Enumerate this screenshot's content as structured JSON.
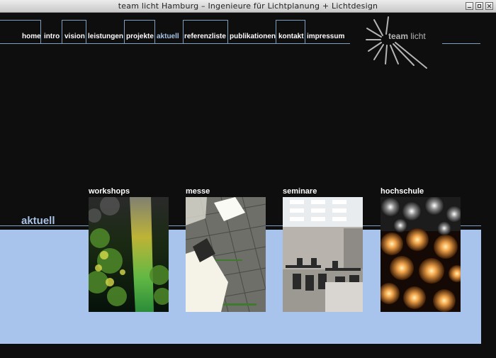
{
  "window": {
    "title": "team licht Hamburg – Ingenieure für Lichtplanung + Lichtdesign"
  },
  "nav": [
    {
      "label": "home"
    },
    {
      "label": "intro"
    },
    {
      "label": "vision"
    },
    {
      "label": "leistungen"
    },
    {
      "label": "projekte"
    },
    {
      "label": "aktuell"
    },
    {
      "label": "referenzliste"
    },
    {
      "label": "publikationen"
    },
    {
      "label": "kontakt"
    },
    {
      "label": "impressum"
    }
  ],
  "logo": {
    "bold": "team",
    "light": "licht"
  },
  "section": {
    "title": "aktuell"
  },
  "cards": [
    {
      "label": "workshops"
    },
    {
      "label": "messe"
    },
    {
      "label": "seminare"
    },
    {
      "label": "hochschule"
    }
  ],
  "colors": {
    "accent": "#a8c3e6",
    "panel": "#a9c4ec",
    "line": "#7f9fbf",
    "background": "#0e0e0e"
  }
}
